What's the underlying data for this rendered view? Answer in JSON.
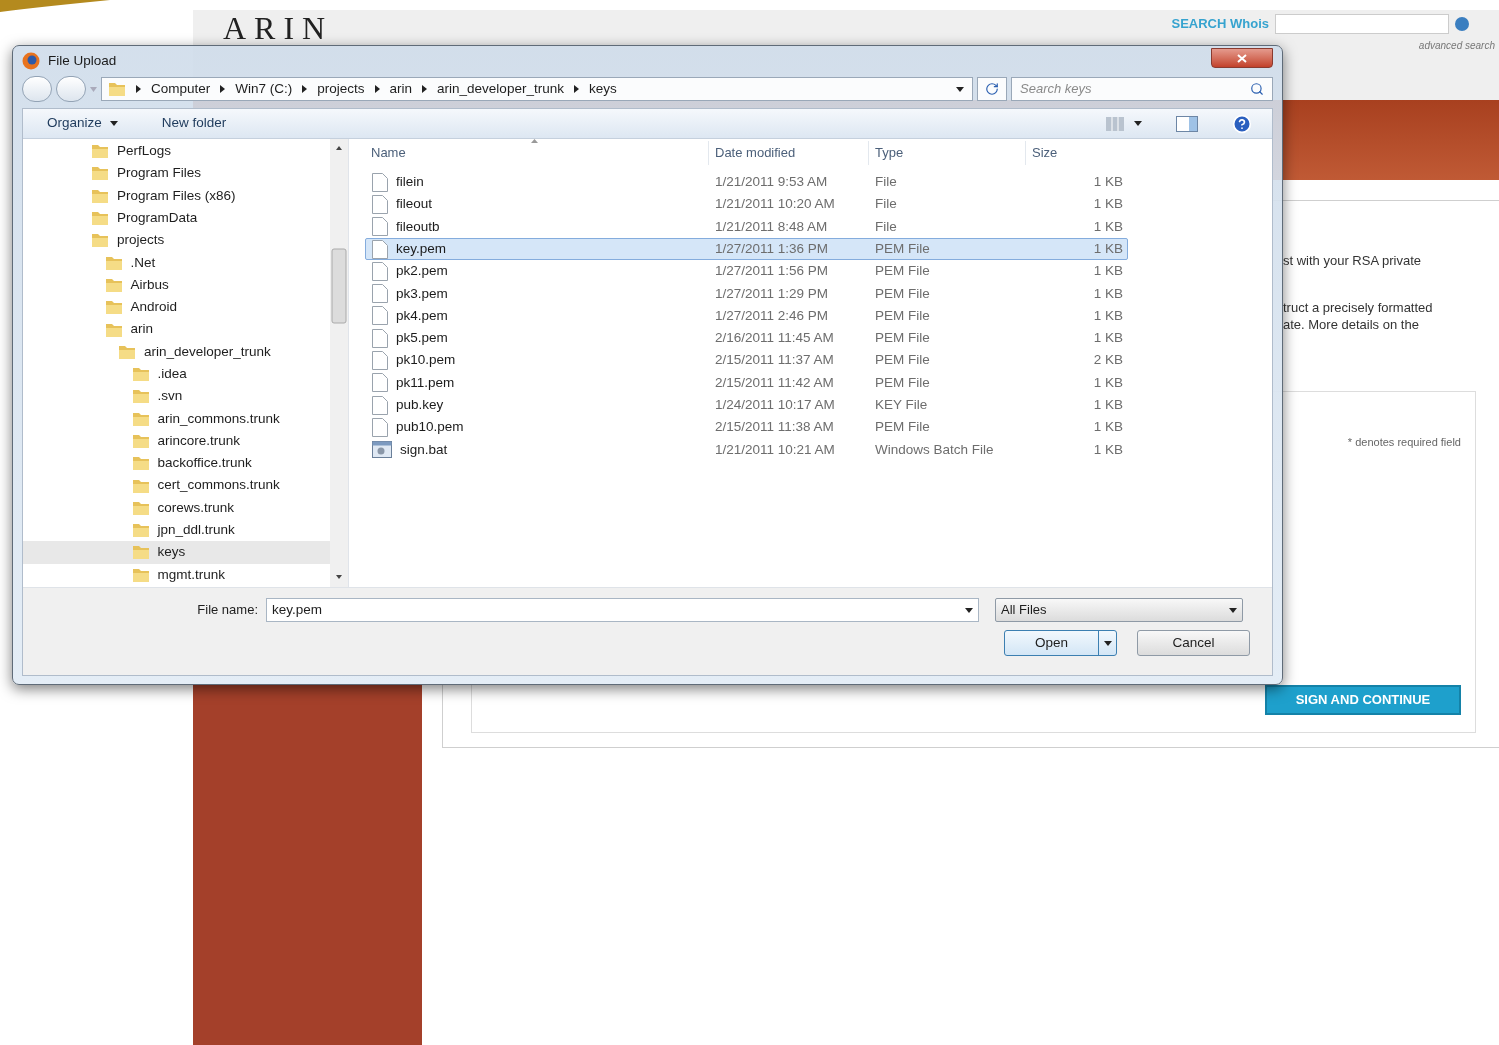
{
  "page": {
    "logo": "ARIN",
    "search_label": "SEARCH Whois",
    "advanced_search": "advanced search",
    "text_lines": [
      "st with your RSA private",
      "truct a precisely formatted",
      "ate. More details on the"
    ],
    "required_note": "* denotes required field",
    "submit": "SIGN AND CONTINUE"
  },
  "dialog": {
    "title": "File Upload",
    "breadcrumb": [
      "Computer",
      "Win7 (C:)",
      "projects",
      "arin",
      "arin_developer_trunk",
      "keys"
    ],
    "search": {
      "placeholder": "Search keys"
    },
    "toolbar": [
      {
        "label": "Organize",
        "menu": true
      },
      {
        "label": "New folder",
        "menu": false
      }
    ],
    "tree": [
      {
        "label": "PerfLogs",
        "selected": false
      },
      {
        "label": "Program Files",
        "selected": false
      },
      {
        "label": "Program Files (x86)",
        "selected": false
      },
      {
        "label": "ProgramData",
        "selected": false
      },
      {
        "label": "projects",
        "selected": false,
        "children": [
          {
            "label": ".Net",
            "selected": false
          },
          {
            "label": "Airbus",
            "selected": false
          },
          {
            "label": "Android",
            "selected": false
          },
          {
            "label": "arin",
            "selected": false,
            "children": [
              {
                "label": "arin_developer_trunk",
                "selected": false,
                "children": [
                  {
                    "label": ".idea",
                    "selected": false
                  },
                  {
                    "label": ".svn",
                    "selected": false
                  },
                  {
                    "label": "arin_commons.trunk",
                    "selected": false
                  },
                  {
                    "label": "arincore.trunk",
                    "selected": false
                  },
                  {
                    "label": "backoffice.trunk",
                    "selected": false
                  },
                  {
                    "label": "cert_commons.trunk",
                    "selected": false
                  },
                  {
                    "label": "corews.trunk",
                    "selected": false
                  },
                  {
                    "label": "jpn_ddl.trunk",
                    "selected": false
                  },
                  {
                    "label": "keys",
                    "selected": true
                  },
                  {
                    "label": "mgmt.trunk",
                    "selected": false
                  }
                ]
              }
            ]
          }
        ]
      }
    ],
    "columns": [
      "Name",
      "Date modified",
      "Type",
      "Size"
    ],
    "files": [
      {
        "name": "filein",
        "date": "1/21/2011 9:53 AM",
        "type": "File",
        "size": "1 KB",
        "kind": "file",
        "selected": false
      },
      {
        "name": "fileout",
        "date": "1/21/2011 10:20 AM",
        "type": "File",
        "size": "1 KB",
        "kind": "file",
        "selected": false
      },
      {
        "name": "fileoutb",
        "date": "1/21/2011 8:48 AM",
        "type": "File",
        "size": "1 KB",
        "kind": "file",
        "selected": false
      },
      {
        "name": "key.pem",
        "date": "1/27/2011 1:36 PM",
        "type": "PEM File",
        "size": "1 KB",
        "kind": "file",
        "selected": true
      },
      {
        "name": "pk2.pem",
        "date": "1/27/2011 1:56 PM",
        "type": "PEM File",
        "size": "1 KB",
        "kind": "file",
        "selected": false
      },
      {
        "name": "pk3.pem",
        "date": "1/27/2011 1:29 PM",
        "type": "PEM File",
        "size": "1 KB",
        "kind": "file",
        "selected": false
      },
      {
        "name": "pk4.pem",
        "date": "1/27/2011 2:46 PM",
        "type": "PEM File",
        "size": "1 KB",
        "kind": "file",
        "selected": false
      },
      {
        "name": "pk5.pem",
        "date": "2/16/2011 11:45 AM",
        "type": "PEM File",
        "size": "1 KB",
        "kind": "file",
        "selected": false
      },
      {
        "name": "pk10.pem",
        "date": "2/15/2011 11:37 AM",
        "type": "PEM File",
        "size": "2 KB",
        "kind": "file",
        "selected": false
      },
      {
        "name": "pk11.pem",
        "date": "2/15/2011 11:42 AM",
        "type": "PEM File",
        "size": "1 KB",
        "kind": "file",
        "selected": false
      },
      {
        "name": "pub.key",
        "date": "1/24/2011 10:17 AM",
        "type": "KEY File",
        "size": "1 KB",
        "kind": "file",
        "selected": false
      },
      {
        "name": "pub10.pem",
        "date": "2/15/2011 11:38 AM",
        "type": "PEM File",
        "size": "1 KB",
        "kind": "file",
        "selected": false
      },
      {
        "name": "sign.bat",
        "date": "1/21/2011 10:21 AM",
        "type": "Windows Batch File",
        "size": "1 KB",
        "kind": "batch",
        "selected": false
      }
    ],
    "file_name": {
      "label": "File name:",
      "value": "key.pem"
    },
    "filter": "All Files",
    "buttons": {
      "open": "Open",
      "cancel": "Cancel"
    }
  }
}
